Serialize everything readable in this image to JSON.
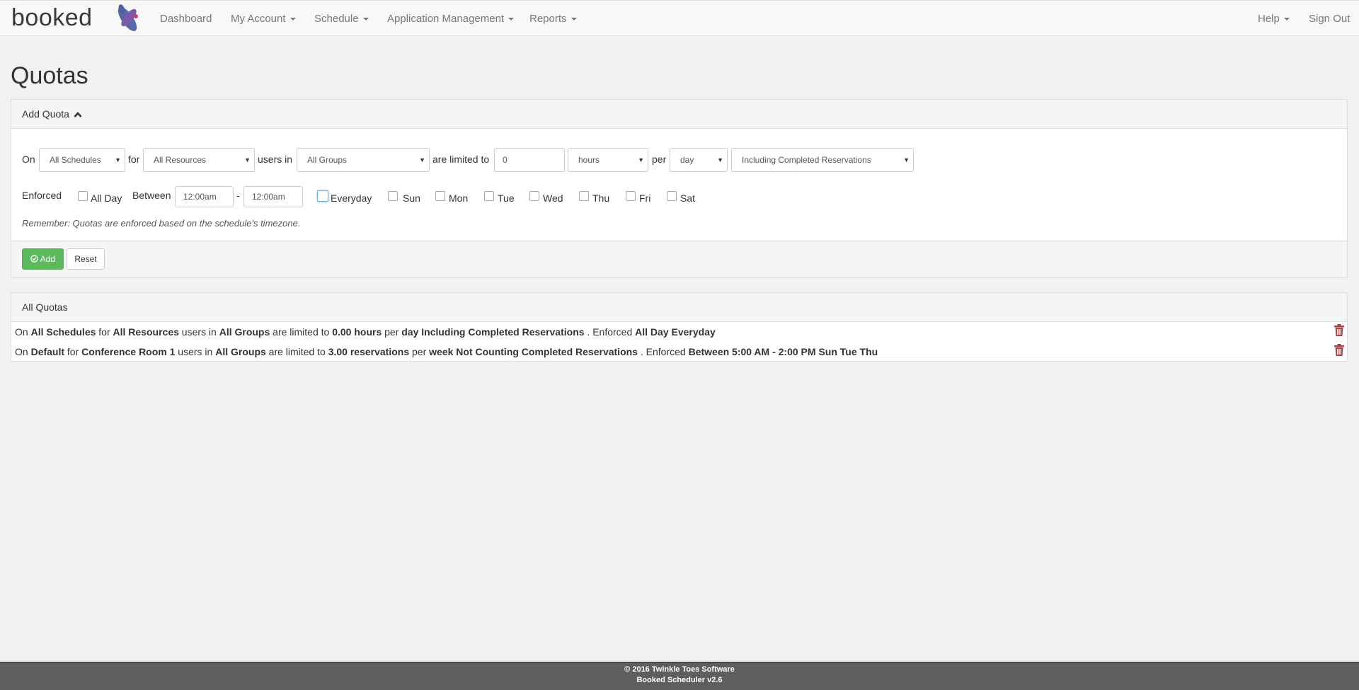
{
  "brand": {
    "name": "booked"
  },
  "nav": {
    "dashboard": "Dashboard",
    "my_account": "My Account",
    "schedule": "Schedule",
    "application_management": "Application Management",
    "reports": "Reports",
    "help": "Help",
    "sign_out": "Sign Out"
  },
  "page": {
    "title": "Quotas"
  },
  "add_quota": {
    "heading": "Add Quota",
    "on_label": "On",
    "schedule_value": "All Schedules",
    "for_label": "for",
    "resource_value": "All Resources",
    "users_in_label": "users in",
    "group_value": "All Groups",
    "limited_to_label": "are limited to",
    "amount_value": "0",
    "unit_value": "hours",
    "per_label": "per",
    "duration_value": "day",
    "completed_value": "Including Completed Reservations",
    "enforced_label": "Enforced",
    "all_day_label": "All Day",
    "between_label": "Between",
    "start_time": "12:00am",
    "dash": "-",
    "end_time": "12:00am",
    "days": {
      "everyday": "Everyday",
      "sun": "Sun",
      "mon": "Mon",
      "tue": "Tue",
      "wed": "Wed",
      "thu": "Thu",
      "fri": "Fri",
      "sat": "Sat"
    },
    "note": "Remember: Quotas are enforced based on the schedule's timezone.",
    "add_button": "Add",
    "reset_button": "Reset"
  },
  "all_quotas": {
    "heading": "All Quotas",
    "rows": [
      {
        "on": "On",
        "schedule": "All Schedules",
        "for": "for",
        "resource": "All Resources",
        "users_in": "users in",
        "group": "All Groups",
        "limited": "are limited to",
        "amount": "0.00 hours",
        "per": "per",
        "duration": "day",
        "completed": "Including Completed Reservations",
        "enforced": ". Enforced",
        "enforcement": "All Day Everyday"
      },
      {
        "on": "On",
        "schedule": "Default",
        "for": "for",
        "resource": "Conference Room 1",
        "users_in": "users in",
        "group": "All Groups",
        "limited": "are limited to",
        "amount": "3.00 reservations",
        "per": "per",
        "duration": "week",
        "completed": "Not Counting Completed Reservations",
        "enforced": ". Enforced",
        "enforcement": "Between 5:00 AM - 2:00 PM Sun Tue Thu"
      }
    ]
  },
  "footer": {
    "copyright": "© 2016 Twinkle Toes Software",
    "version": "Booked Scheduler v2.6"
  },
  "colors": {
    "add_button": "#5cb85c",
    "trash_icon": "#a94442",
    "footer_bg": "#5e5e5e",
    "focus_border": "#66afe9"
  },
  "icons": {
    "brand_logo": "booked-logo-icon",
    "collapse": "chevron-up-icon",
    "add": "add-circle-icon",
    "delete": "trash-icon",
    "dropdown": "caret-down-icon"
  }
}
